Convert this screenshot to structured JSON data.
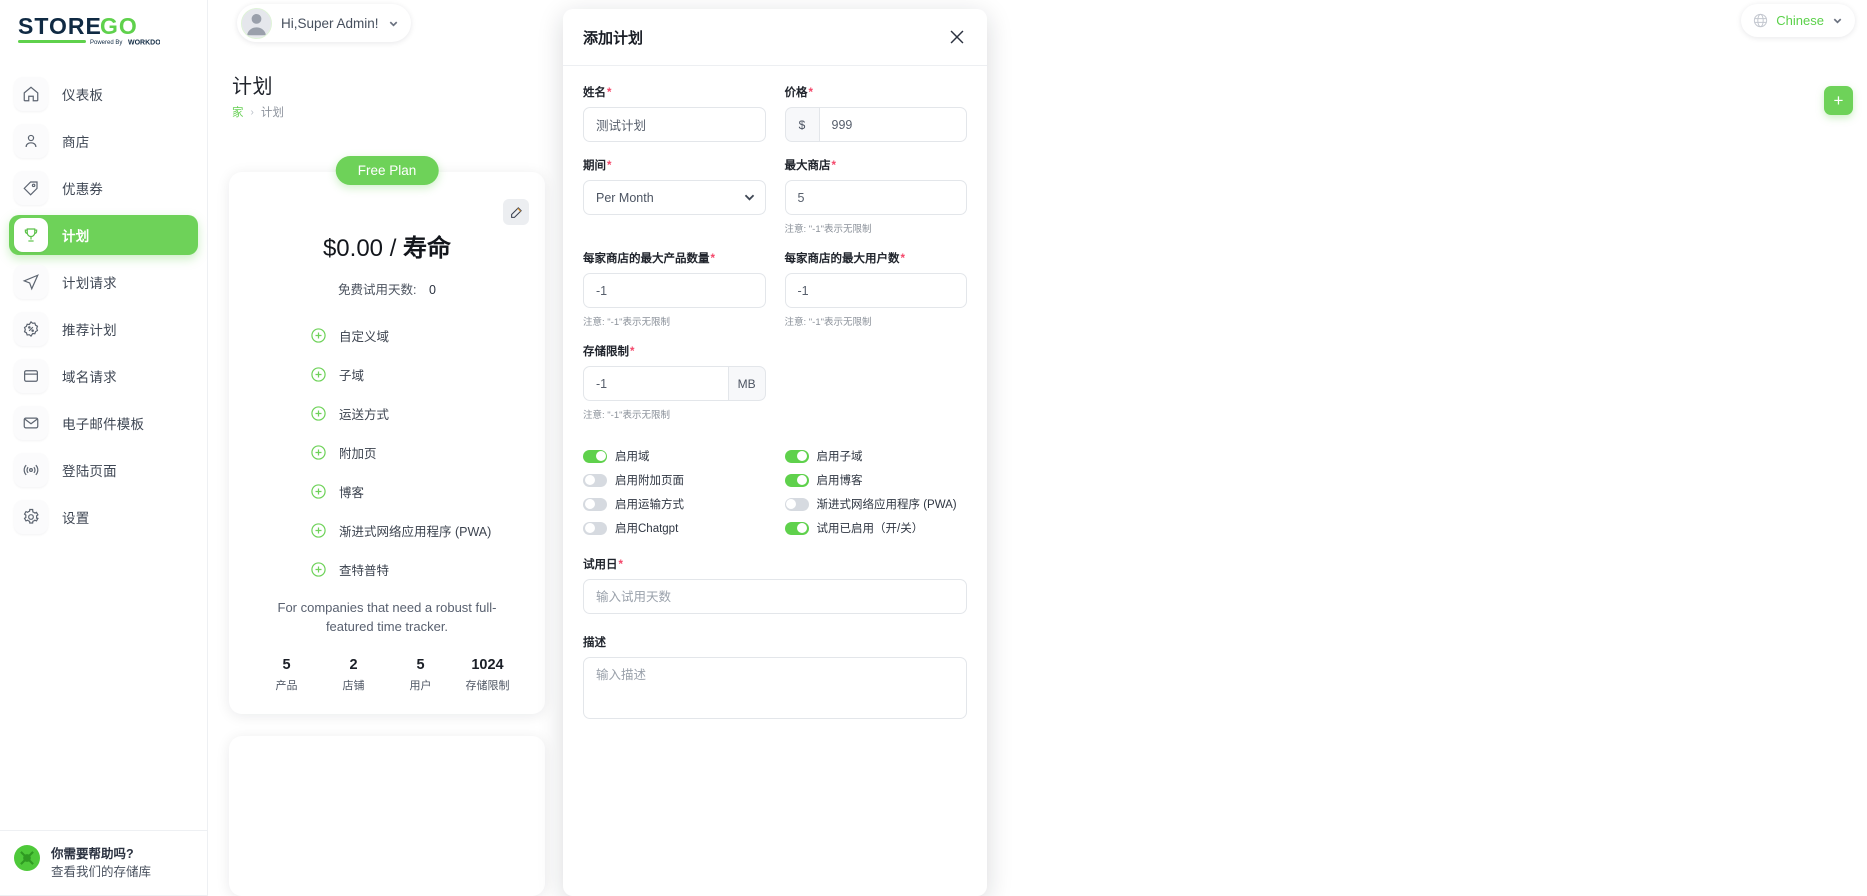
{
  "brand": {
    "name": "STOREGO",
    "tagline": "Powered By WORKDO",
    "accent": "#6ed259"
  },
  "sidebar": {
    "items": [
      {
        "label": "仪表板",
        "icon": "home-icon",
        "active": false
      },
      {
        "label": "商店",
        "icon": "user-icon",
        "active": false
      },
      {
        "label": "优惠券",
        "icon": "tag-icon",
        "active": false
      },
      {
        "label": "计划",
        "icon": "trophy-icon",
        "active": true
      },
      {
        "label": "计划请求",
        "icon": "send-icon",
        "active": false
      },
      {
        "label": "推荐计划",
        "icon": "percent-badge-icon",
        "active": false
      },
      {
        "label": "域名请求",
        "icon": "window-icon",
        "active": false
      },
      {
        "label": "电子邮件模板",
        "icon": "mail-icon",
        "active": false
      },
      {
        "label": "登陆页面",
        "icon": "broadcast-icon",
        "active": false
      },
      {
        "label": "设置",
        "icon": "gear-icon",
        "active": false
      }
    ],
    "help": {
      "title": "你需要帮助吗?",
      "subtitle": "查看我们的存储库"
    }
  },
  "topbar": {
    "profile_greeting": "Hi,Super Admin!",
    "language": "Chinese",
    "add_button": "+"
  },
  "page": {
    "title": "计划",
    "breadcrumb_home": "家",
    "breadcrumb_sep": "›",
    "breadcrumb_current": "计划"
  },
  "plan_card": {
    "badge": "Free Plan",
    "price_currency": "$0.00",
    "price_separator": "/",
    "price_period": "寿命",
    "trial_label": "免费试用天数:",
    "trial_value": "0",
    "features": [
      "自定义域",
      "子域",
      "运送方式",
      "附加页",
      "博客",
      "渐进式网络应用程序 (PWA)",
      "查特普特"
    ],
    "description": "For companies that need a robust full-featured time tracker.",
    "stats": [
      {
        "value": "5",
        "label": "产品"
      },
      {
        "value": "2",
        "label": "店铺"
      },
      {
        "value": "5",
        "label": "用户"
      },
      {
        "value": "1024",
        "label": "存储限制"
      }
    ]
  },
  "modal": {
    "title": "添加计划",
    "close_icon": "close-icon",
    "fields": {
      "name_label": "姓名",
      "name_value": "测试计划",
      "price_label": "价格",
      "price_addon": "$",
      "price_value": "999",
      "duration_label": "期间",
      "duration_value": "Per Month",
      "max_stores_label": "最大商店",
      "max_stores_value": "5",
      "max_stores_hint": "注意: \"-1\"表示无限制",
      "max_products_label": "每家商店的最大产品数量",
      "max_products_value": "-1",
      "max_products_hint": "注意: \"-1\"表示无限制",
      "max_users_label": "每家商店的最大用户数",
      "max_users_value": "-1",
      "max_users_hint": "注意: \"-1\"表示无限制",
      "storage_label": "存储限制",
      "storage_value": "-1",
      "storage_addon": "MB",
      "storage_hint": "注意: \"-1\"表示无限制",
      "trial_days_label": "试用日",
      "trial_days_placeholder": "输入试用天数",
      "description_label": "描述",
      "description_placeholder": "输入描述"
    },
    "toggles_left": [
      {
        "label": "启用域",
        "on": true
      },
      {
        "label": "启用附加页面",
        "on": false
      },
      {
        "label": "启用运输方式",
        "on": false
      },
      {
        "label": "启用Chatgpt",
        "on": false
      }
    ],
    "toggles_right": [
      {
        "label": "启用子域",
        "on": true
      },
      {
        "label": "启用博客",
        "on": true
      },
      {
        "label": "渐进式网络应用程序 (PWA)",
        "on": false
      },
      {
        "label": "试用已启用（开/关）",
        "on": true
      }
    ]
  }
}
